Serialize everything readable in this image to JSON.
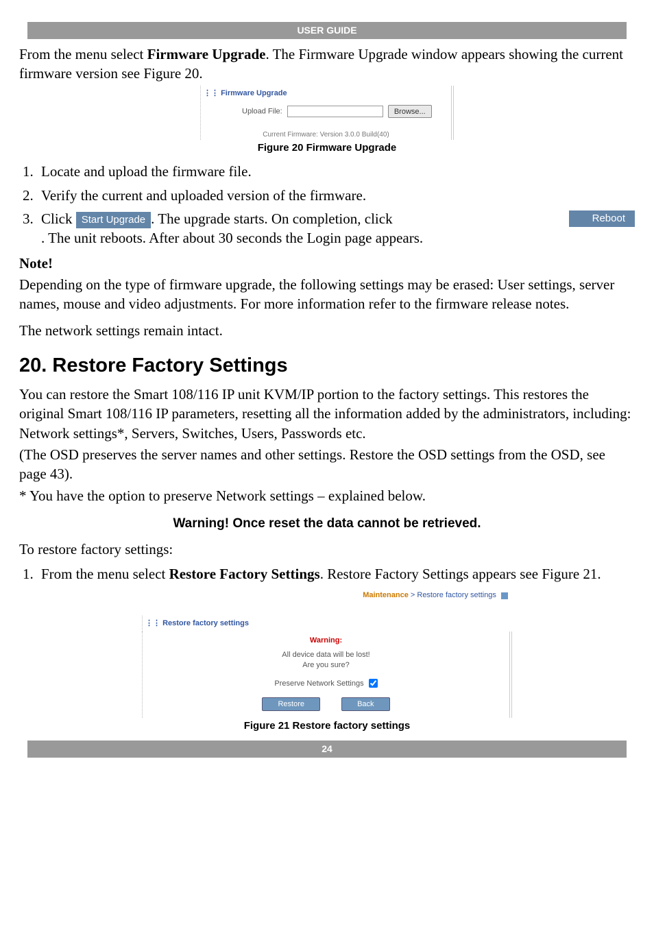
{
  "header": {
    "title": "USER GUIDE"
  },
  "intro": "From the menu select Firmware Upgrade. The Firmware Upgrade window appears showing the current firmware version see Figure 20.",
  "fig20": {
    "panel_title": "Firmware Upgrade",
    "upload_label": "Upload File:",
    "browse_label": "Browse...",
    "version_text": "Current Firmware: Version 3.0.0 Build(40)",
    "caption": "Figure 20 Firmware Upgrade"
  },
  "steps_a": {
    "s1": "Locate and upload the firmware file.",
    "s2": "Verify the current and uploaded version of the firmware.",
    "s3_prefix": "Click",
    "start_upgrade_btn": "Start Upgrade",
    "s3_mid": ". The upgrade starts. On completion, click",
    "reboot_btn": "Reboot",
    "s3_suffix": ". The unit reboots. After about 30 seconds the Login page appears."
  },
  "note_heading": "Note!",
  "note_body": "Depending on the type of firmware upgrade, the following settings may be erased: User settings, server names, mouse and video adjustments. For more information refer to the firmware release notes.",
  "note_body2": "The network settings remain intact.",
  "section20": {
    "title": "20. Restore Factory Settings",
    "p1": "You can restore the Smart 108/116 IP unit KVM/IP portion to the factory settings. This restores the original Smart 108/116 IP parameters, resetting all the information added by the administrators, including: Network settings*, Servers, Switches, Users, Passwords etc.",
    "p2": "(The OSD preserves the server names and other settings. Restore the OSD settings from the OSD, see page 43).",
    "p3": "* You have the option to preserve Network settings – explained below.",
    "warning": "Warning! Once reset the data cannot be retrieved.",
    "p4": "To restore factory settings:",
    "step1": "From the menu select Restore Factory Settings. Restore Factory Settings appears see Figure 21."
  },
  "fig21": {
    "crumb1": "Maintenance",
    "crumb_sep": " > ",
    "crumb2": "Restore factory settings",
    "panel_title": "Restore factory settings",
    "warning": "Warning:",
    "lost1": "All device data will be lost!",
    "lost2": "Are you sure?",
    "preserve": "Preserve Network Settings",
    "restore_btn": "Restore",
    "back_btn": "Back",
    "caption": "Figure 21 Restore factory settings"
  },
  "footer": {
    "page": "24"
  }
}
